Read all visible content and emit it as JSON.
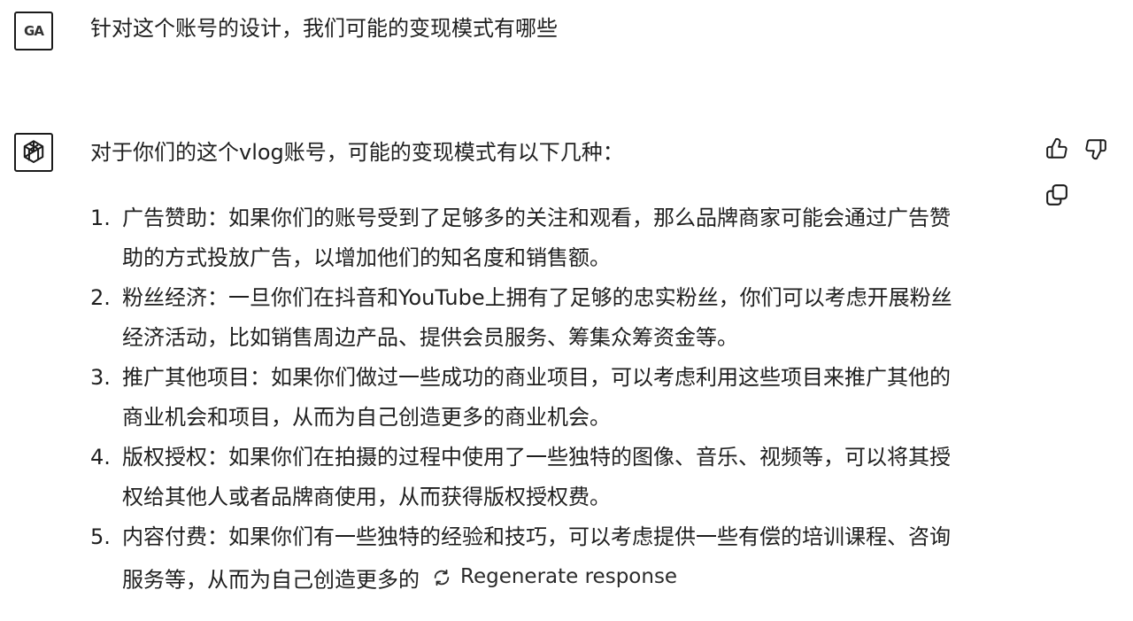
{
  "user": {
    "avatar_text": "GA",
    "message": "针对这个账号的设计，我们可能的变现模式有哪些"
  },
  "assistant": {
    "intro": "对于你们的这个vlog账号，可能的变现模式有以下几种：",
    "points": [
      {
        "num": "1.",
        "lines": [
          "广告赞助：如果你们的账号受到了足够多的关注和观看，那么品牌商家可能会通过广告赞",
          "助的方式投放广告，以增加他们的知名度和销售额。"
        ]
      },
      {
        "num": "2.",
        "lines": [
          "粉丝经济：一旦你们在抖音和YouTube上拥有了足够的忠实粉丝，你们可以考虑开展粉丝",
          "经济活动，比如销售周边产品、提供会员服务、筹集众筹资金等。"
        ]
      },
      {
        "num": "3.",
        "lines": [
          "推广其他项目：如果你们做过一些成功的商业项目，可以考虑利用这些项目来推广其他的",
          "商业机会和项目，从而为自己创造更多的商业机会。"
        ]
      },
      {
        "num": "4.",
        "lines": [
          "版权授权：如果你们在拍摄的过程中使用了一些独特的图像、音乐、视频等，可以将其授",
          "权给其他人或者品牌商使用，从而获得版权授权费。"
        ]
      },
      {
        "num": "5.",
        "lines": [
          "内容付费：如果你们有一些独特的经验和技巧，可以考虑提供一些有偿的培训课程、咨询",
          "服务等，从而为自己创造更多的"
        ]
      }
    ],
    "regenerate_label": "Regenerate response"
  },
  "icons": {
    "bot_avatar": "openai-logo-icon",
    "thumb_up": "thumb-up-icon",
    "thumb_down": "thumb-down-icon",
    "copy": "copy-icon",
    "regenerate": "refresh-icon"
  }
}
